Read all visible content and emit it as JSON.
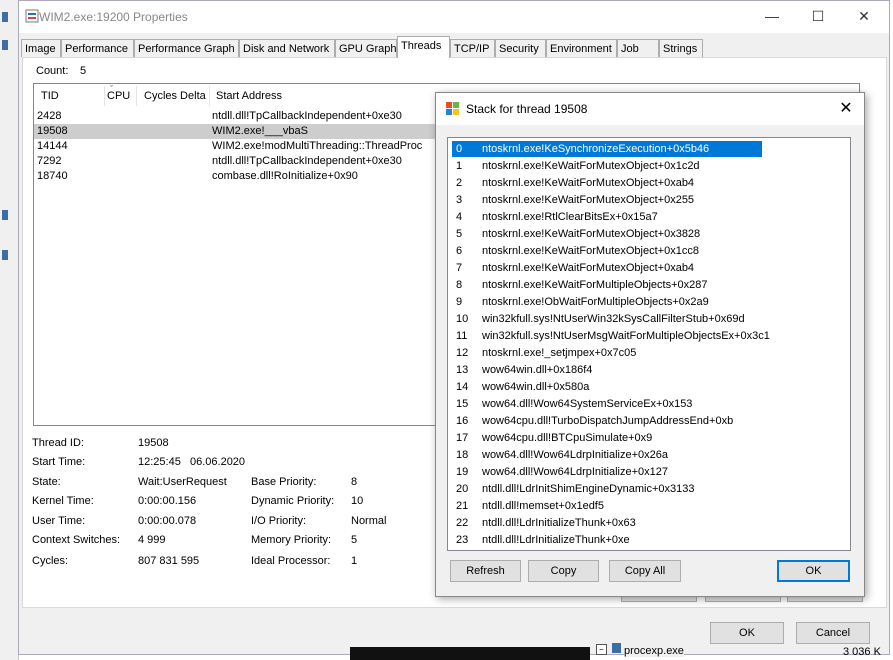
{
  "window": {
    "title": "WIM2.exe:19200 Properties",
    "minimize_glyph": "—",
    "maximize_glyph": "☐",
    "close_glyph": "✕"
  },
  "tabs": [
    {
      "label": "Image"
    },
    {
      "label": "Performance"
    },
    {
      "label": "Performance Graph"
    },
    {
      "label": "Disk and Network"
    },
    {
      "label": "GPU Graph"
    },
    {
      "label": "Threads",
      "active": true
    },
    {
      "label": "TCP/IP"
    },
    {
      "label": "Security"
    },
    {
      "label": "Environment"
    },
    {
      "label": "Job"
    },
    {
      "label": "Strings"
    }
  ],
  "threads": {
    "count_label": "Count:",
    "count_value": "5",
    "columns": {
      "tid": "TID",
      "cpu": "CPU",
      "cycles": "Cycles Delta",
      "start": "Start Address"
    },
    "rows": [
      {
        "tid": "2428",
        "start": "ntdll.dll!TpCallbackIndependent+0xe30"
      },
      {
        "tid": "19508",
        "start": "WIM2.exe!___vbaS",
        "selected": true
      },
      {
        "tid": "14144",
        "start": "WIM2.exe!modMultiThreading::ThreadProc"
      },
      {
        "tid": "7292",
        "start": "ntdll.dll!TpCallbackIndependent+0xe30"
      },
      {
        "tid": "18740",
        "start": "combase.dll!RoInitialize+0x90"
      }
    ]
  },
  "details": {
    "thread_id_label": "Thread ID:",
    "thread_id": "19508",
    "start_time_label": "Start Time:",
    "start_time": "12:25:45   06.06.2020",
    "state_label": "State:",
    "state": "Wait:UserRequest",
    "kernel_label": "Kernel Time:",
    "kernel": "0:00:00.156",
    "user_label": "User Time:",
    "user": "0:00:00.078",
    "ctx_label": "Context Switches:",
    "ctx": "4 999",
    "cycles_label": "Cycles:",
    "cycles": "807 831 595",
    "base_label": "Base Priority:",
    "base": "8",
    "dyn_label": "Dynamic Priority:",
    "dyn": "10",
    "io_label": "I/O Priority:",
    "io": "Normal",
    "mem_label": "Memory Priority:",
    "mem": "5",
    "ideal_label": "Ideal Processor:",
    "ideal": "1"
  },
  "main_buttons": {
    "ok": "OK",
    "cancel": "Cancel"
  },
  "background": {
    "taskbar_text": "procexp.exe",
    "size_text": "3 036 K"
  },
  "stack_dialog": {
    "title": "Stack for thread 19508",
    "close_glyph": "✕",
    "frames": [
      "ntoskrnl.exe!KeSynchronizeExecution+0x5b46",
      "ntoskrnl.exe!KeWaitForMutexObject+0x1c2d",
      "ntoskrnl.exe!KeWaitForMutexObject+0xab4",
      "ntoskrnl.exe!KeWaitForMutexObject+0x255",
      "ntoskrnl.exe!RtlClearBitsEx+0x15a7",
      "ntoskrnl.exe!KeWaitForMutexObject+0x3828",
      "ntoskrnl.exe!KeWaitForMutexObject+0x1cc8",
      "ntoskrnl.exe!KeWaitForMutexObject+0xab4",
      "ntoskrnl.exe!KeWaitForMultipleObjects+0x287",
      "ntoskrnl.exe!ObWaitForMultipleObjects+0x2a9",
      "win32kfull.sys!NtUserWin32kSysCallFilterStub+0x69d",
      "win32kfull.sys!NtUserMsgWaitForMultipleObjectsEx+0x3c1",
      "ntoskrnl.exe!_setjmpex+0x7c05",
      "wow64win.dll+0x186f4",
      "wow64win.dll+0x580a",
      "wow64.dll!Wow64SystemServiceEx+0x153",
      "wow64cpu.dll!TurboDispatchJumpAddressEnd+0xb",
      "wow64cpu.dll!BTCpuSimulate+0x9",
      "wow64.dll!Wow64LdrpInitialize+0x26a",
      "wow64.dll!Wow64LdrpInitialize+0x127",
      "ntdll.dll!LdrInitShimEngineDynamic+0x3133",
      "ntdll.dll!memset+0x1edf5",
      "ntdll.dll!LdrInitializeThunk+0x63",
      "ntdll.dll!LdrInitializeThunk+0xe"
    ],
    "buttons": {
      "refresh": "Refresh",
      "copy": "Copy",
      "copy_all": "Copy All",
      "ok": "OK"
    }
  }
}
